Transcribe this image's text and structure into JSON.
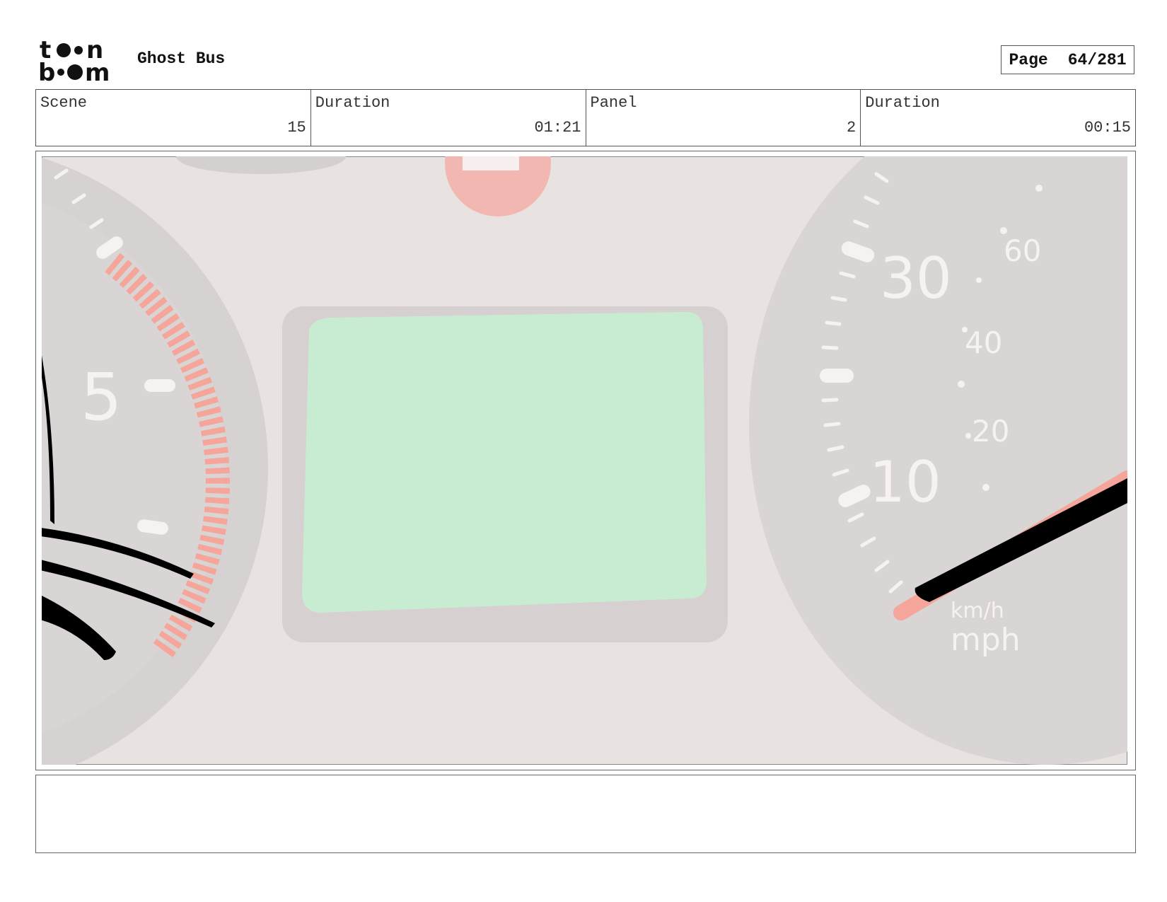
{
  "header": {
    "logo_text": "toon boom",
    "project_title": "Ghost Bus",
    "page_label": "Page",
    "page_number": "64/281"
  },
  "info": [
    {
      "label": "Scene",
      "value": "15"
    },
    {
      "label": "Duration",
      "value": "01:21"
    },
    {
      "label": "Panel",
      "value": "2"
    },
    {
      "label": "Duration",
      "value": "00:15"
    }
  ],
  "panel": {
    "tach_number": "5",
    "speed_labels_large": [
      "30",
      "10"
    ],
    "speed_labels_small": [
      "60",
      "40",
      "20"
    ],
    "unit_kmh": "km/h",
    "unit_mph": "mph",
    "colors": {
      "background": "#e8e2e0",
      "gauge": "#d9d5d4",
      "screen": "#c8ecd2",
      "red_zone": "#f5a59a",
      "ink": "#000000"
    }
  },
  "notes": {}
}
